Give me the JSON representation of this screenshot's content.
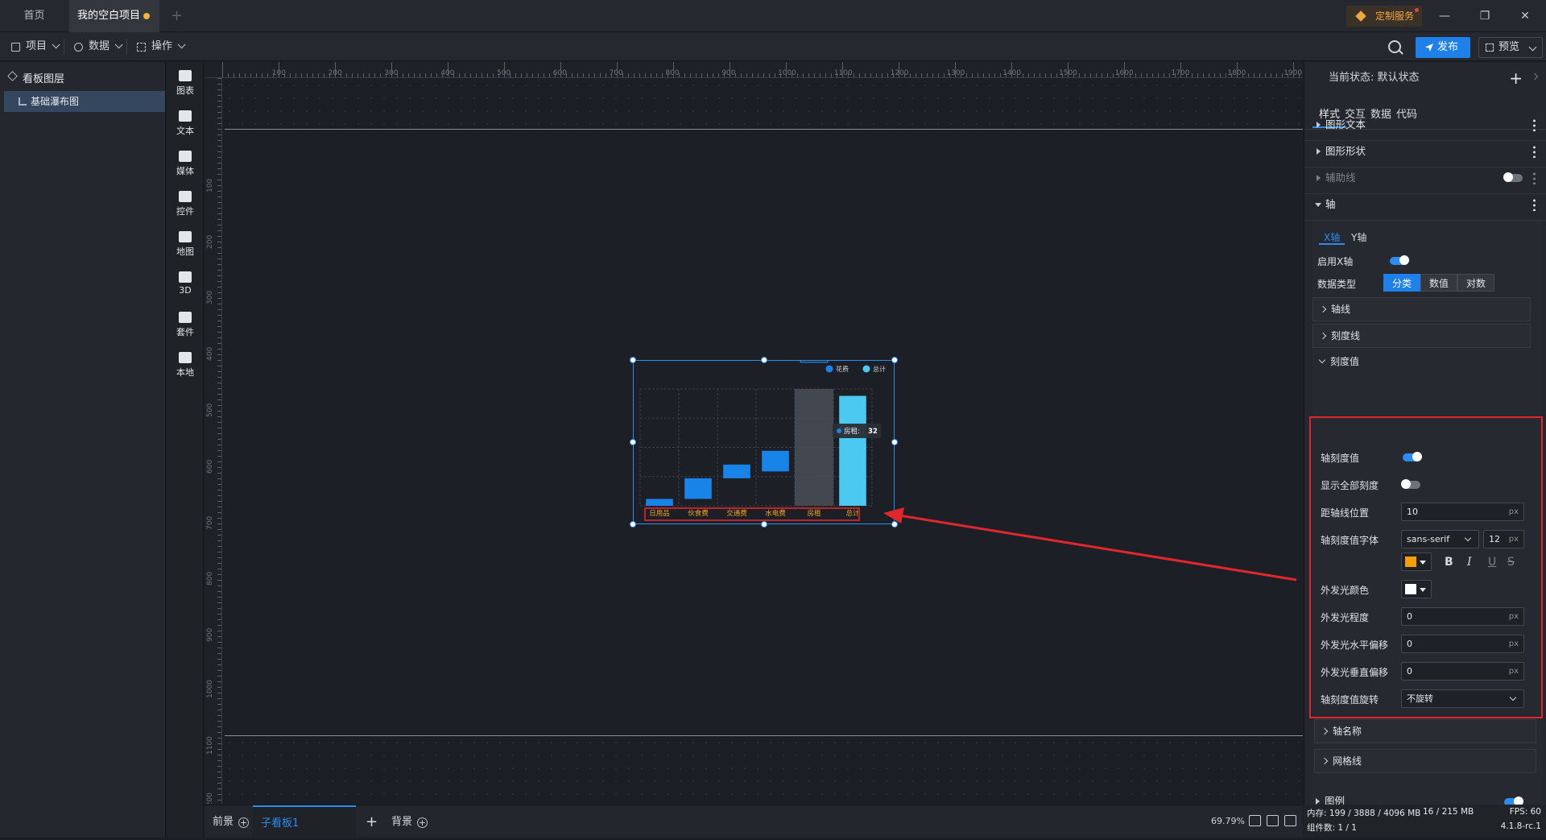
{
  "tabs": {
    "home": "首页",
    "project": "我的空白项目"
  },
  "custom_service": "定制服务",
  "menu": {
    "project": "项目",
    "data": "数据",
    "operate": "操作"
  },
  "toolbar": {
    "publish": "发布",
    "preview": "预览"
  },
  "layers": {
    "title": "看板图层",
    "items": [
      {
        "label": "基础瀑布图"
      }
    ]
  },
  "components": [
    "图表",
    "文本",
    "媒体",
    "控件",
    "地图",
    "3D",
    "套件",
    "本地"
  ],
  "ruler": {
    "top": [
      "100",
      "200",
      "300",
      "400",
      "500",
      "600",
      "700",
      "800",
      "900",
      "1000",
      "1100",
      "1200",
      "1300",
      "1400",
      "1500",
      "1600",
      "1700",
      "1800",
      "1900"
    ],
    "left": [
      "100",
      "200",
      "300",
      "400",
      "500",
      "600",
      "700",
      "800",
      "900",
      "1000",
      "1100",
      "1200"
    ]
  },
  "chart_data": {
    "type": "bar",
    "title": "",
    "categories": [
      "日用品",
      "伙食费",
      "交通费",
      "水电费",
      "房租",
      "总计"
    ],
    "series": [
      {
        "name": "花费",
        "base": [
          0,
          2,
          8,
          10,
          14,
          0
        ],
        "values": [
          2,
          6,
          4,
          6,
          32,
          32
        ],
        "color": "#1884e8"
      },
      {
        "name": "总计",
        "color": "#4cc9f0"
      }
    ],
    "tooltip": {
      "label": "房租",
      "value": "32"
    },
    "legend_position": "top-right",
    "grid": true,
    "tick_label_color": "#f5a623"
  },
  "bottom": {
    "front": "前景",
    "child_board": "子看板1",
    "background": "背景",
    "zoom": "69.79%"
  },
  "panel": {
    "state_label": "当前状态:",
    "state_value": "默认状态",
    "tabs": [
      "样式",
      "交互",
      "数据",
      "代码"
    ],
    "sections": {
      "graphic_text": "图形文本",
      "graphic_shape": "图形形状",
      "aux_line": "辅助线",
      "axis": "轴",
      "legend": "图例"
    },
    "axis_tabs": [
      "X轴",
      "Y轴"
    ],
    "enable_x": "启用X轴",
    "data_type": "数据类型",
    "data_type_options": [
      "分类",
      "数值",
      "对数"
    ],
    "folds": {
      "axis_line": "轴线",
      "tick_line": "刻度线",
      "tick_value": "刻度值",
      "axis_name": "轴名称",
      "grid_line": "网格线"
    },
    "tick": {
      "show_label": "轴刻度值",
      "show_all_label": "显示全部刻度",
      "distance_label": "距轴线位置",
      "distance_value": "10",
      "font_label": "轴刻度值字体",
      "font_family": "sans-serif",
      "font_size": "12",
      "font_color": "#f5a000",
      "glow_color_label": "外发光颜色",
      "glow_color": "#ffffff",
      "glow_level_label": "外发光程度",
      "glow_level": "0",
      "glow_h_label": "外发光水平偏移",
      "glow_h": "0",
      "glow_v_label": "外发光垂直偏移",
      "glow_v": "0",
      "rotate_label": "轴刻度值旋转",
      "rotate_value": "不旋转"
    },
    "unit_px": "px"
  },
  "status": {
    "memory": "内存: 199 / 3888 / 4096 MB",
    "mem2": "16 / 215 MB",
    "fps": "FPS: 60",
    "components": "组件数: 1 / 1",
    "version": "4.1.8-rc.1"
  }
}
